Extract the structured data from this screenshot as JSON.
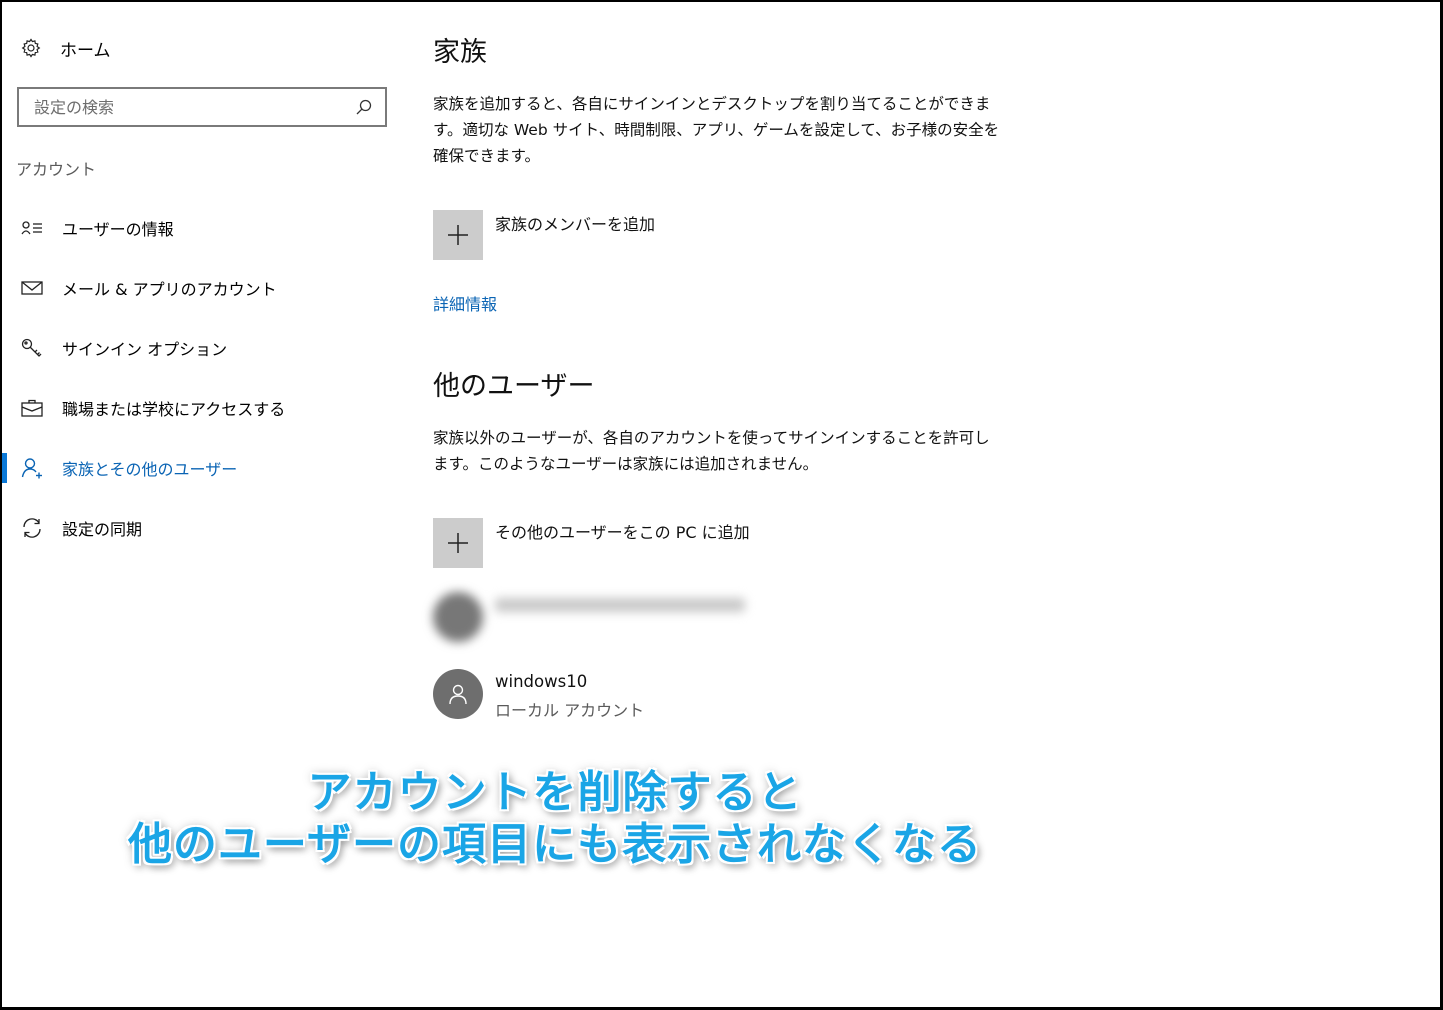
{
  "sidebar": {
    "home_label": "ホーム",
    "search_placeholder": "設定の検索",
    "section_label": "アカウント",
    "items": [
      {
        "label": "ユーザーの情報",
        "icon": "user-info-icon"
      },
      {
        "label": "メール & アプリのアカウント",
        "icon": "mail-icon"
      },
      {
        "label": "サインイン オプション",
        "icon": "key-icon"
      },
      {
        "label": "職場または学校にアクセスする",
        "icon": "briefcase-icon"
      },
      {
        "label": "家族とその他のユーザー",
        "icon": "person-icon",
        "active": true
      },
      {
        "label": "設定の同期",
        "icon": "sync-icon"
      }
    ]
  },
  "family": {
    "title": "家族",
    "description": "家族を追加すると、各自にサインインとデスクトップを割り当てることができます。適切な Web サイト、時間制限、アプリ、ゲームを設定して、お子様の安全を確保できます。",
    "add_label": "家族のメンバーを追加",
    "more_info_link": "詳細情報"
  },
  "other_users": {
    "title": "他のユーザー",
    "description": "家族以外のユーザーが、各自のアカウントを使ってサインインすることを許可します。このようなユーザーは家族には追加されません。",
    "add_label": "その他のユーザーをこの PC に追加",
    "users": [
      {
        "name": "windows10",
        "type": "ローカル アカウント"
      }
    ]
  },
  "annotation": {
    "line1": "アカウントを削除すると",
    "line2": "他のユーザーの項目にも表示されなくなる",
    "color": "#1aa5e6"
  },
  "colors": {
    "accent": "#0a78d7",
    "link": "#0a64b4",
    "tile": "#cccccc"
  }
}
